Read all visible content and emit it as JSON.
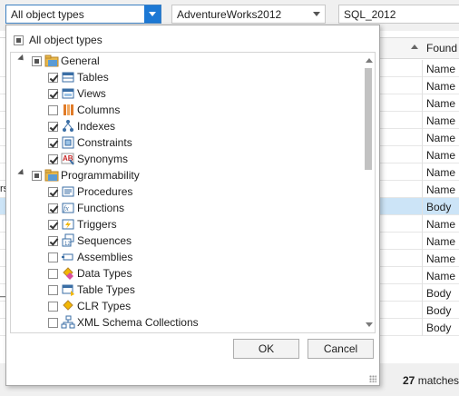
{
  "filters": {
    "object_type": "All object types",
    "database": "AdventureWorks2012",
    "server": "SQL_2012"
  },
  "grid": {
    "column_header": "Found I",
    "left_fragments": [
      "rs",
      "_F"
    ],
    "rows": [
      "Name",
      "Name",
      "Name",
      "Name",
      "Name",
      "Name",
      "Name",
      "Name",
      "Body",
      "Name",
      "Name",
      "Name",
      "Name",
      "Body",
      "Body",
      "Body"
    ]
  },
  "status": {
    "count": "27",
    "text": " matches f"
  },
  "popup": {
    "all_label": "All object types",
    "tree": [
      {
        "label": "General",
        "level": 0,
        "state": "partial",
        "icon": "folder-icon"
      },
      {
        "label": "Tables",
        "level": 1,
        "state": "checked",
        "icon": "table-icon"
      },
      {
        "label": "Views",
        "level": 1,
        "state": "checked",
        "icon": "view-icon"
      },
      {
        "label": "Columns",
        "level": 1,
        "state": "unchecked",
        "icon": "columns-icon"
      },
      {
        "label": "Indexes",
        "level": 1,
        "state": "checked",
        "icon": "index-icon"
      },
      {
        "label": "Constraints",
        "level": 1,
        "state": "checked",
        "icon": "constraint-icon"
      },
      {
        "label": "Synonyms",
        "level": 1,
        "state": "checked",
        "icon": "synonym-icon"
      },
      {
        "label": "Programmability",
        "level": 0,
        "state": "partial",
        "icon": "folder-icon"
      },
      {
        "label": "Procedures",
        "level": 1,
        "state": "checked",
        "icon": "procedure-icon"
      },
      {
        "label": "Functions",
        "level": 1,
        "state": "checked",
        "icon": "function-icon"
      },
      {
        "label": "Triggers",
        "level": 1,
        "state": "checked",
        "icon": "trigger-icon"
      },
      {
        "label": "Sequences",
        "level": 1,
        "state": "checked",
        "icon": "sequence-icon"
      },
      {
        "label": "Assemblies",
        "level": 1,
        "state": "unchecked",
        "icon": "assembly-icon"
      },
      {
        "label": "Data Types",
        "level": 1,
        "state": "unchecked",
        "icon": "data-type-icon"
      },
      {
        "label": "Table Types",
        "level": 1,
        "state": "unchecked",
        "icon": "table-type-icon"
      },
      {
        "label": "CLR Types",
        "level": 1,
        "state": "unchecked",
        "icon": "clr-type-icon"
      },
      {
        "label": "XML Schema Collections",
        "level": 1,
        "state": "unchecked",
        "icon": "xml-schema-icon"
      }
    ],
    "ok_label": "OK",
    "cancel_label": "Cancel"
  }
}
